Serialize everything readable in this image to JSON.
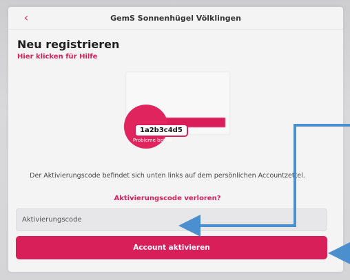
{
  "header": {
    "title": "GemS Sonnenhügel Völklingen",
    "back_icon": "chevron-left-icon"
  },
  "page": {
    "heading": "Neu registrieren",
    "help_link": "Hier klicken für Hilfe"
  },
  "illustration": {
    "example_code": "1a2b3c4d5",
    "caption_fragment": "Probleme bei de"
  },
  "instructions": "Der Aktivierungscode befindet sich unten links auf dem persönlichen Accountzettel.",
  "lost_code_link": "Aktivierungscode verloren?",
  "form": {
    "code_placeholder": "Aktivierungscode",
    "code_value": "",
    "submit_label": "Account aktivieren"
  },
  "colors": {
    "accent": "#d81f5a",
    "annotation_arrow": "#4c8fcf"
  }
}
